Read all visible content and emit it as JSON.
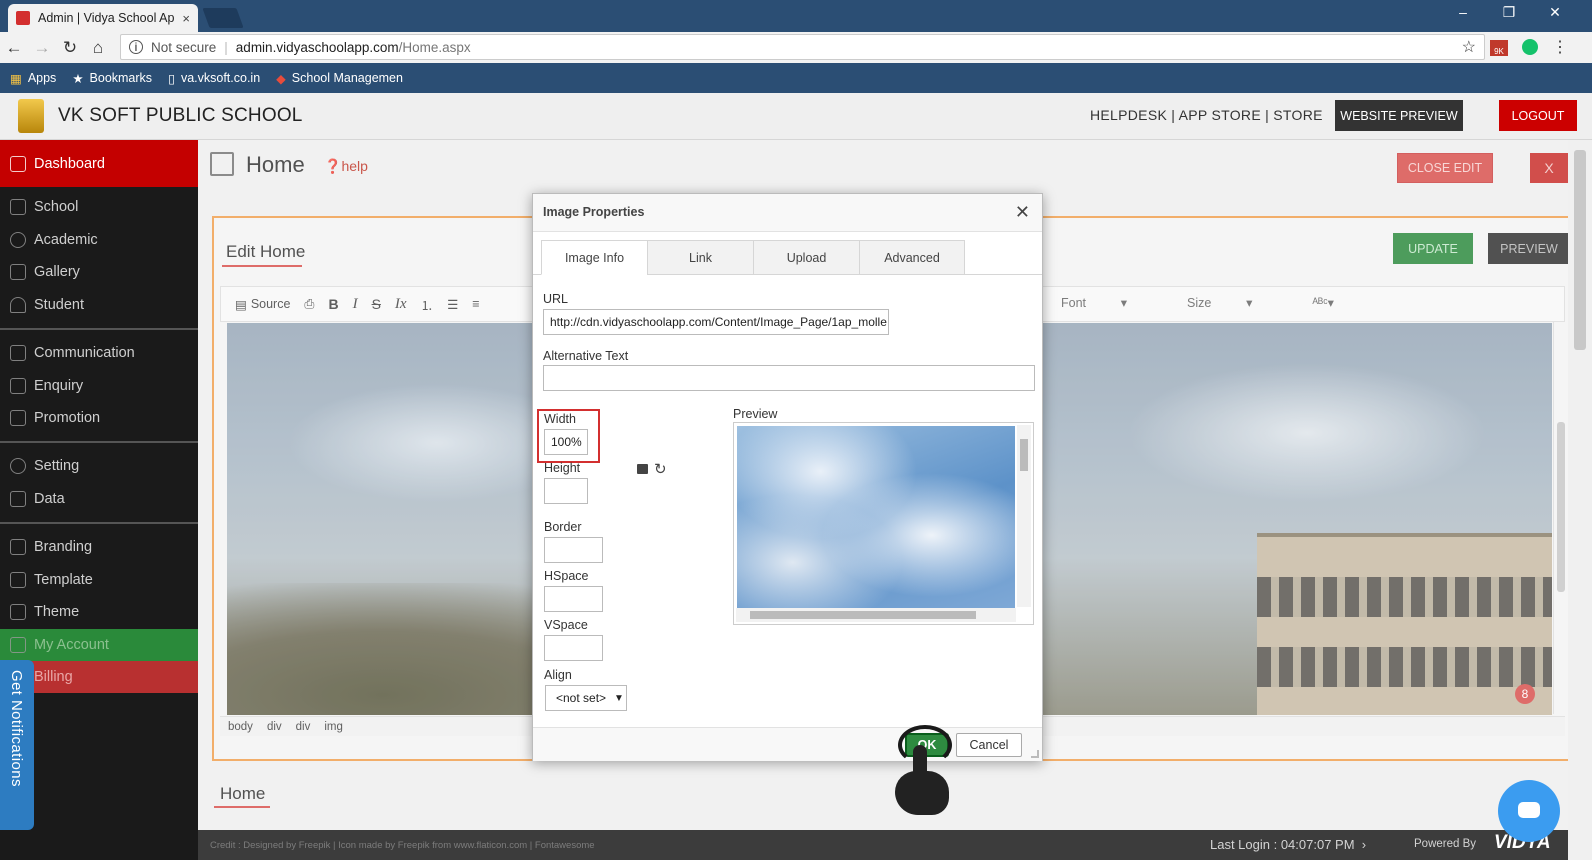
{
  "browser": {
    "tab_title": "Admin | Vidya School Ap",
    "tab_close": "×",
    "win_min": "–",
    "win_restore": "❐",
    "win_close": "✕",
    "url_security": "Not secure",
    "url_host": "admin.vidyaschoolapp.com",
    "url_path": "/Home.aspx",
    "ext_badge": "9K",
    "bookmarks": [
      "Apps",
      "Bookmarks",
      "va.vksoft.co.in",
      "School Managemen"
    ]
  },
  "header": {
    "school_name": "VK SOFT PUBLIC SCHOOL",
    "links": "HELPDESK  |  APP STORE  |  STORE",
    "website_preview": "WEBSITE PREVIEW",
    "logout": "LOGOUT"
  },
  "sidebar": {
    "items": [
      {
        "label": "Dashboard"
      },
      {
        "label": "School"
      },
      {
        "label": "Academic"
      },
      {
        "label": "Gallery"
      },
      {
        "label": "Student"
      },
      {
        "label": "Communication"
      },
      {
        "label": "Enquiry"
      },
      {
        "label": "Promotion"
      },
      {
        "label": "Setting"
      },
      {
        "label": "Data"
      },
      {
        "label": "Branding"
      },
      {
        "label": "Template"
      },
      {
        "label": "Theme"
      },
      {
        "label": "My Account"
      },
      {
        "label": "Billing"
      }
    ],
    "notifications_tab": "Get Notifications"
  },
  "page": {
    "title": "Home",
    "help": "help",
    "close_edit": "CLOSE EDIT",
    "close_x": "X",
    "edit_heading": "Edit Home",
    "update": "UPDATE",
    "preview": "PREVIEW",
    "toolbar_source": "Source",
    "toolbar_font": "Font",
    "toolbar_size": "Size",
    "path": [
      "body",
      "div",
      "div",
      "img"
    ],
    "badge_count": "8",
    "bottom_heading": "Home"
  },
  "footer": {
    "credit": "Credit : Designed by Freepik | Icon made by Freepik from www.flaticon.com | Fontawesome",
    "last_login": "Last Login : 04:07:07 PM",
    "powered_by": "Powered By",
    "brand": "VIDYA"
  },
  "dialog": {
    "title": "Image Properties",
    "tabs": [
      "Image Info",
      "Link",
      "Upload",
      "Advanced"
    ],
    "active_tab": "Image Info",
    "url_label": "URL",
    "url_value": "http://cdn.vidyaschoolapp.com/Content/Image_Page/1ap_molle",
    "alt_label": "Alternative Text",
    "alt_value": "",
    "width_label": "Width",
    "width_value": "100%",
    "height_label": "Height",
    "height_value": "",
    "border_label": "Border",
    "hspace_label": "HSpace",
    "vspace_label": "VSpace",
    "align_label": "Align",
    "align_value": "<not set>",
    "preview_label": "Preview",
    "ok": "OK",
    "cancel": "Cancel"
  },
  "colors": {
    "chrome_blue": "#2b4e74",
    "danger_red": "#c40000",
    "success_green": "#2e8b40",
    "accent_orange": "#f0a050"
  }
}
